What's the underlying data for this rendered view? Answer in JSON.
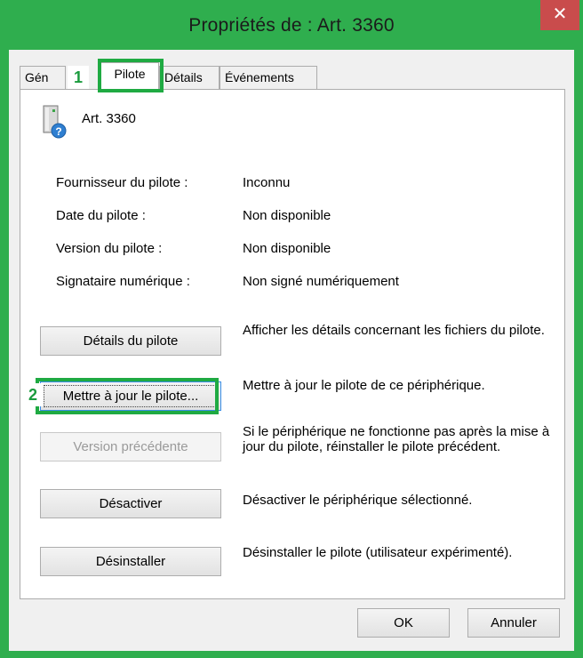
{
  "window": {
    "title": "Propriétés de : Art. 3360",
    "close_glyph": "✕"
  },
  "tabs": [
    {
      "label": "Gén"
    },
    {
      "label": "Pilote"
    },
    {
      "label": "Détails"
    },
    {
      "label": "Événements"
    }
  ],
  "badges": {
    "one": "1",
    "two": "2"
  },
  "device": {
    "name": "Art. 3360",
    "icon": "device-unknown-icon"
  },
  "driver_info": [
    {
      "label": "Fournisseur du pilote :",
      "value": "Inconnu"
    },
    {
      "label": "Date du pilote :",
      "value": "Non disponible"
    },
    {
      "label": "Version du pilote :",
      "value": "Non disponible"
    },
    {
      "label": "Signataire numérique :",
      "value": "Non signé numériquement"
    }
  ],
  "actions": [
    {
      "label": "Détails du pilote",
      "description": "Afficher les détails concernant les fichiers du pilote."
    },
    {
      "label": "Mettre à jour le pilote...",
      "description": "Mettre à jour le pilote de ce périphérique."
    },
    {
      "label": "Version précédente",
      "description": "Si le périphérique ne fonctionne pas après la mise à jour du pilote, réinstaller le pilote précédent."
    },
    {
      "label": "Désactiver",
      "description": "Désactiver le périphérique sélectionné."
    },
    {
      "label": "Désinstaller",
      "description": "Désinstaller le pilote (utilisateur expérimenté)."
    }
  ],
  "footer": {
    "ok": "OK",
    "cancel": "Annuler"
  },
  "colors": {
    "frame": "#2fae4e",
    "highlight": "#1faa42",
    "close": "#c94c4c"
  }
}
